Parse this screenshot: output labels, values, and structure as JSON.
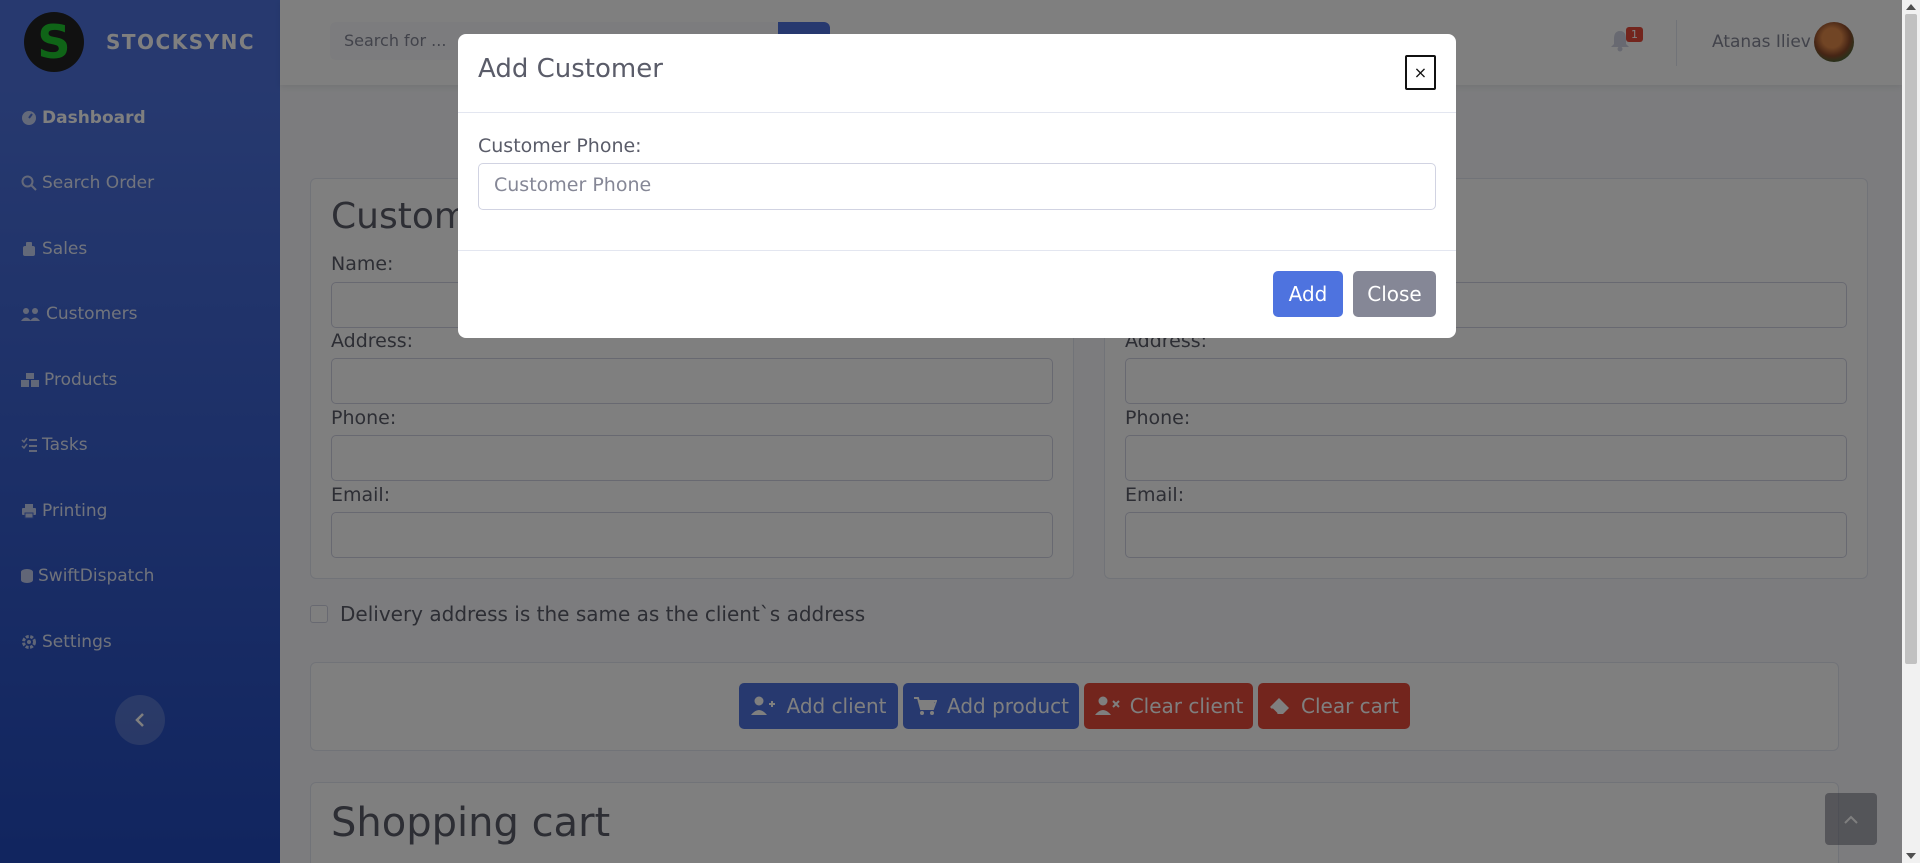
{
  "brand": {
    "logo_letter": "S",
    "name": "STOCKSYNC",
    "logo_color": "#1fc82f"
  },
  "sidebar": {
    "items": [
      {
        "label": "Dashboard",
        "icon": "dashboard-icon",
        "active": true
      },
      {
        "label": "Search Order",
        "icon": "search-icon"
      },
      {
        "label": "Sales",
        "icon": "sales-icon"
      },
      {
        "label": "Customers",
        "icon": "users-icon"
      },
      {
        "label": "Products",
        "icon": "boxes-icon"
      },
      {
        "label": "Tasks",
        "icon": "list-check-icon"
      },
      {
        "label": "Printing",
        "icon": "printer-icon"
      },
      {
        "label": "SwiftDispatch",
        "icon": "dispatch-icon"
      },
      {
        "label": "Settings",
        "icon": "gear-icon"
      }
    ]
  },
  "topbar": {
    "search_placeholder": "Search for ...",
    "notification_count": "1",
    "user_name": "Atanas Iliev"
  },
  "main": {
    "customer_card_title": "Custome",
    "left_form": {
      "name_label": "Name:",
      "address_label": "Address:",
      "phone_label": "Phone:",
      "email_label": "Email:"
    },
    "right_form": {
      "address_label": "Address:",
      "phone_label": "Phone:",
      "email_label": "Email:"
    },
    "delivery_checkbox_label": "Delivery address is the same as the client`s address",
    "actions": {
      "add_client": "Add client",
      "add_product": "Add product",
      "clear_client": "Clear client",
      "clear_cart": "Clear cart"
    },
    "shopping_cart_title": "Shopping cart"
  },
  "modal": {
    "title": "Add Customer",
    "close_symbol": "×",
    "phone_label": "Customer Phone:",
    "phone_placeholder": "Customer Phone",
    "phone_value": "",
    "add_label": "Add",
    "close_label": "Close"
  },
  "colors": {
    "primary": "#4e73df",
    "danger": "#e74a3b",
    "secondary": "#858796"
  }
}
